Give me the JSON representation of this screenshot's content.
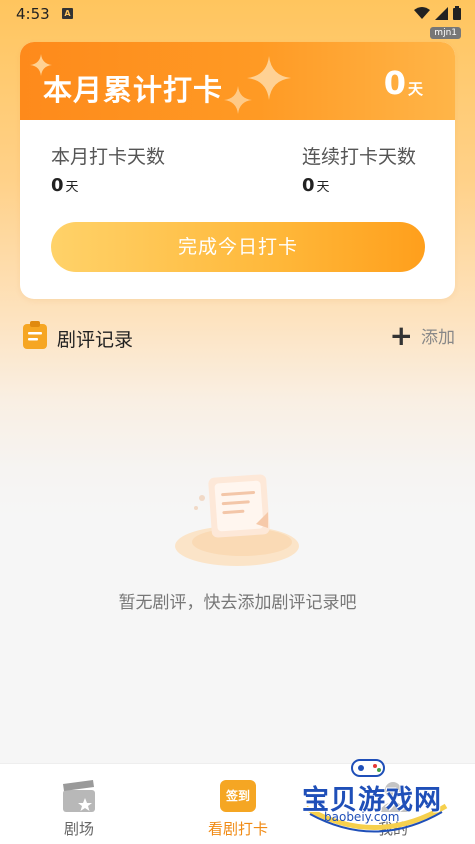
{
  "status_bar": {
    "time": "4:53",
    "tag": "mjn1"
  },
  "checkin_card": {
    "title": "本月累计打卡",
    "total_value": "0",
    "total_unit": "天",
    "stats": [
      {
        "label": "本月打卡天数",
        "value": "0",
        "unit": "天"
      },
      {
        "label": "连续打卡天数",
        "value": "0",
        "unit": "天"
      }
    ],
    "button_label": "完成今日打卡"
  },
  "reviews": {
    "title": "剧评记录",
    "add_label": "添加",
    "empty_text": "暂无剧评，快去添加剧评记录吧"
  },
  "bottom_nav": {
    "items": [
      {
        "label": "剧场",
        "icon": "clapperboard-icon",
        "active": false
      },
      {
        "label": "看剧打卡",
        "icon": "calendar-checkin-icon",
        "active": true,
        "icon_text": "签到"
      },
      {
        "label": "我的",
        "icon": "profile-icon",
        "active": false
      }
    ]
  },
  "watermark": {
    "text": "宝贝游戏网",
    "url": "baobeiy.com"
  },
  "colors": {
    "accent": "#ff9a24",
    "active_nav": "#f08a14",
    "card_header_start": "#fe8a1b",
    "card_header_end": "#ffb548"
  }
}
